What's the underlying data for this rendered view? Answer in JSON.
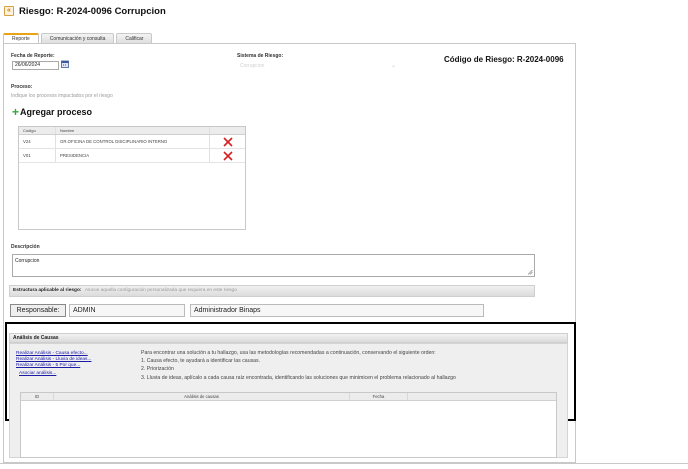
{
  "header": {
    "back_icon": "back-arrow-icon",
    "title": "Riesgo: R-2024-0096 Corrupcion"
  },
  "tabs": [
    {
      "label": "Reporte",
      "active": true
    },
    {
      "label": "Comunicación y consulta",
      "active": false
    },
    {
      "label": "Calificar",
      "active": false
    }
  ],
  "report": {
    "fecha_label": "Fecha de Reporte:",
    "fecha_value": "26/06/2024",
    "sistema_label": "Sistema de Riesgo:",
    "sistema_value": "Corrupcion",
    "codigo": "Código de Riesgo: R-2024-0096",
    "proceso_label": "Proceso:",
    "proceso_hint": "Indique los procesos impactados por el riesgo",
    "add_proceso": "Agregar proceso"
  },
  "process_table": {
    "columns": [
      "Código",
      "Nombre",
      ""
    ],
    "rows": [
      {
        "code": "V24",
        "name": "GR.OFICINA DE CONTROL DISCIPLINARIO INTERNO"
      },
      {
        "code": "V01",
        "name": "PRESIDENCIA"
      }
    ]
  },
  "descripcion": {
    "label": "Descripción",
    "value": "Corrupcion"
  },
  "estructura": {
    "label": "Estructura aplicable al riesgo:",
    "hint": "Asocie aquella configuración personalizada que requiera en este riesgo"
  },
  "responsable": {
    "label": "Responsable:",
    "user": "ADMIN",
    "name": "Administrador Binaps"
  },
  "analisis": {
    "title": "Análisis de Causas",
    "links": [
      "Realizar Análisis - Causa efecto...",
      "Realizar Análisis - Lluvia de ideas...",
      "Realizar Análisis - 5 Por que...",
      "Asociar análisis..."
    ],
    "instructions": [
      "Para encontrar una solución a tu hallazgo, usa las metodologías recomendadas a continuación, conservando el siguiente orden:",
      "1. Causa efecto, te ayudará a identificar las causas.",
      "2. Priorización",
      "3. Lluvia de ideas, aplícalo a cada causa raíz encontrada, identificando las soluciones que minimicen el problema relacionado al hallazgo"
    ],
    "table_columns": [
      "ID",
      "Análisis de causas",
      "Fecha",
      ""
    ]
  },
  "colors": {
    "tab_accent": "#e8a317",
    "add_green": "#2ea82e",
    "delete_red": "#d62020",
    "link_blue": "#1a1aa6"
  }
}
